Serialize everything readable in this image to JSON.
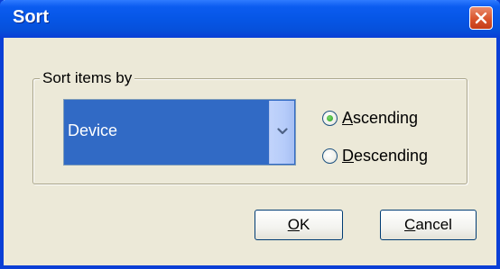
{
  "window": {
    "title": "Sort"
  },
  "group": {
    "legend": "Sort items by",
    "select": {
      "value": "Device"
    },
    "order": {
      "ascending": {
        "label_first": "A",
        "label_rest": "scending",
        "checked": true
      },
      "descending": {
        "label_first": "D",
        "label_rest": "escending",
        "checked": false
      }
    }
  },
  "buttons": {
    "ok": {
      "mnemonic": "O",
      "rest": "K"
    },
    "cancel": {
      "mnemonic": "C",
      "rest": "ancel"
    }
  },
  "colors": {
    "title_bar": "#0656e6",
    "selection": "#316ac5",
    "dialog_bg": "#ece9d8",
    "close_button": "#d9542c"
  },
  "icons": {
    "close": "close-icon",
    "dropdown": "chevron-down-icon"
  }
}
